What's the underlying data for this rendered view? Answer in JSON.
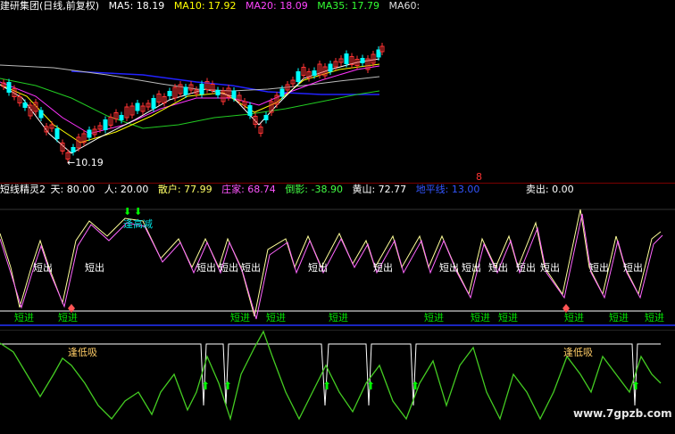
{
  "top_header": {
    "title": "建研集团(日线,前复权)",
    "ma5": "MA5: 18.19",
    "ma10": "MA10: 17.92",
    "ma20": "MA20: 18.09",
    "ma35": "MA35: 17.79",
    "ma60": "MA60:",
    "low_price_label": "←10.19",
    "high_marker": "8"
  },
  "mid_header": {
    "name": "短线精灵2",
    "tian": "天: 80.00",
    "ren": "人: 20.00",
    "sanhu": "散户: 77.99",
    "zhuangjia": "庄家: 68.74",
    "daoying": "倒影: -38.90",
    "huangshan": "黄山: 72.77",
    "dipingxian": "地平线: 13.00",
    "maichu": "卖出: 0.00"
  },
  "labels": {
    "short_out": "短出",
    "short_in": "短进",
    "take_profit": "逢高减",
    "buy_dip": "逢低吸"
  },
  "watermark": "www.7gpzb.com",
  "colors": {
    "background": "#000000",
    "up": "#ff3333",
    "down": "#00ffff",
    "ma5": "#ffffff",
    "ma10": "#ffff00",
    "ma20": "#ff00ff",
    "ma35": "#00ff00",
    "ma60": "#cccccc",
    "base_line": "#0000ff"
  }
}
